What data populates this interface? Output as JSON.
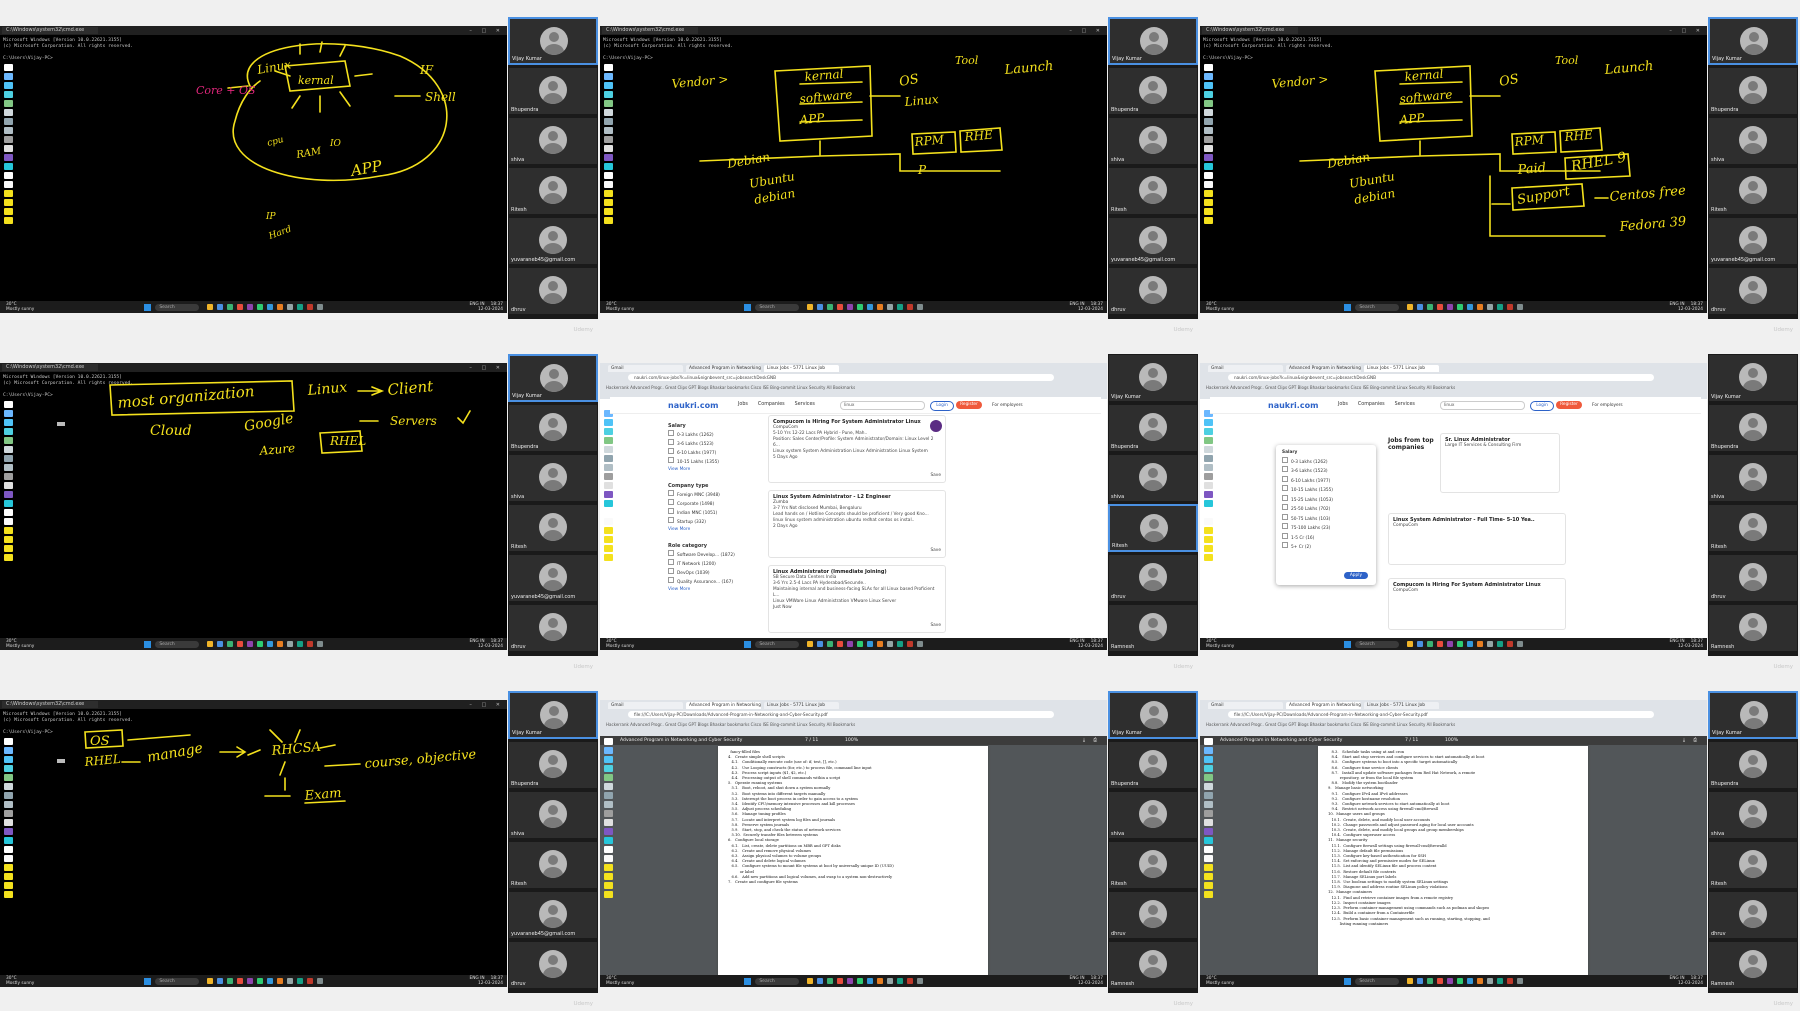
{
  "watermark": "Udemy",
  "participants": [
    "Vijay Kumar",
    "Bhupendra",
    "shiva",
    "Ritesh",
    "yuvaraneb45@gmail.com",
    "dhruv"
  ],
  "participants_alt": [
    "Vijay Kumar",
    "Bhupendra",
    "shiva",
    "Ritesh",
    "dhruv",
    "Ramnesh"
  ],
  "cmd": {
    "window_title": "C:\\Windows\\system32\\cmd.exe",
    "line1": "Microsoft Windows [Version 10.0.22621.3155]",
    "line2": "(c) Microsoft Corporation. All rights reserved.",
    "line3": "C:\\Users\\Vijay-PC>"
  },
  "taskbar": {
    "search": "Search",
    "weather": "30°C",
    "weather_sub": "Mostly sunny",
    "lang": "ENG IN",
    "time": "18:37",
    "date": "12-03-2024"
  },
  "annotations": {
    "t1": [
      "Linux",
      "Core + OS",
      "kernal",
      "IF",
      "Shell",
      "cpu",
      "RAM",
      "IO",
      "APP",
      "IP",
      "Hard"
    ],
    "t2": [
      "Vendor >",
      "kernal",
      "software",
      "APP",
      "OS",
      "Tool",
      "Launch",
      "Linux",
      "Debian",
      "Ubuntu",
      "debian",
      "RPM",
      "RHE",
      "P"
    ],
    "t3": [
      "Vendor >",
      "kernal",
      "software",
      "APP",
      "OS",
      "Tool",
      "Launch",
      "Debian",
      "Ubuntu",
      "debian",
      "RPM",
      "RHE",
      "Paid",
      "RHEL 9",
      "Support",
      "Centos free",
      "Fedora 39"
    ],
    "t4": [
      "most organization",
      "Linux",
      "Client",
      "Cloud",
      "Google",
      "Azure",
      "RHEL",
      "Servers"
    ],
    "t7": [
      "OS",
      "RHEL",
      "manage",
      "RHCSA",
      "course, objective",
      "Exam"
    ]
  },
  "naukri": {
    "logo": "naukri.com",
    "nav": [
      "Jobs",
      "Companies",
      "Services"
    ],
    "search": "linux",
    "login": "Login",
    "register": "Register",
    "employers": "For employers",
    "address": "naukri.com/linux-jobs?k=linux&nignbevent_src=jobsearchDeskGNB",
    "bookmarks": "Hackerrank  Advanced Progr..  Great Clips  GPT  Blogs  Bhaskar bookmarks  Cisco ISE  Bing-commit  Linux Security  All Bookmarks",
    "tabs": [
      "Gmail",
      "Advanced Program in Networking",
      "Linux Jobs - 5771 Linux Job"
    ],
    "filters": {
      "salary_title": "Salary",
      "salary": [
        "0-3 Lakhs (1262)",
        "3-6 Lakhs (1523)",
        "6-10 Lakhs (1977)",
        "10-15 Lakhs (1355)"
      ],
      "company_title": "Company type",
      "company": [
        "Foreign MNC (3948)",
        "Corporate (1498)",
        "Indian MNC (1051)",
        "Startup (332)"
      ],
      "role_title": "Role category",
      "role": [
        "Software Develop... (1872)",
        "IT Network (1200)",
        "DevOps (1039)",
        "Quality Assurance... (167)"
      ],
      "view_more": "View More"
    },
    "jobs": [
      {
        "title": "Compucom is Hiring For System Administrator Linux",
        "company": "CompuCom",
        "meta": "5-10 Yrs   12-22 Lacs PA   Hybrid - Pune, Mah..",
        "desc": "Position: Sales Center/Profile: System Administrator/Domain: Linux Level 2 6...",
        "tags": "Linux system  System Administration  Linux Administration  Linux System",
        "when": "5 Days Ago",
        "save": "Save"
      },
      {
        "title": "Linux System Administrator - L2 Engineer",
        "company": "Zumba",
        "meta": "3-7 Yrs   Not disclosed   Mumbai, Bengaluru",
        "desc": "Lead hands on / Hotline Concepts should be proficient / Very good Kno...",
        "tags": "linux  linux system administration  ubuntu  redhat  centos  os  instal..",
        "when": "2 Days Ago",
        "save": "Save"
      },
      {
        "title": "Linux Administrator (Immediate Joining)",
        "company": "SB Secure Data Centers India",
        "meta": "3-6 Yrs   2.5-4 Lacs PA   Hyderabad/Secunde..",
        "desc": "Maintaining internal and business-facing SLAs for all Linux based Proficient L...",
        "tags": "Linux  VMWare  Linux Administration  VMware  Linux Server",
        "when": "Just Now",
        "save": "Save"
      }
    ],
    "popup": {
      "title": "Salary",
      "items": [
        "0-3 Lakhs (1262)",
        "3-6 Lakhs (1523)",
        "6-10 Lakhs (1977)",
        "10-15 Lakhs (1355)",
        "15-25 Lakhs (1053)",
        "25-50 Lakhs (702)",
        "50-75 Lakhs (103)",
        "75-100 Lakhs (23)",
        "1-5 Cr (16)",
        "5+ Cr (2)"
      ],
      "apply": "Apply"
    },
    "right_jobs": [
      {
        "title": "Sr. Linux Administrator",
        "company": "Large IT Services & Consulting Firm"
      },
      {
        "title": "Linux System Administrator - Full Time- 5-10 Yea..",
        "company": "CompuCom"
      },
      {
        "title": "Compucom is Hiring For System Administrator Linux",
        "company": "CompuCom"
      }
    ],
    "promo": "Jobs from top companies"
  },
  "pdf": {
    "title": "Advanced Program in Networking and Cyber Security",
    "page1": "7 / 11",
    "page2": "7 / 11",
    "zoom": "100%",
    "address": "file:///C:/Users/Vijay-PC/Downloads/Advanced-Program-in-Networking-and-Cyber-Security.pdf",
    "doc1": [
      "  fancy-filled files",
      "4.   Create simple shell scripts",
      "   4.1.   Conditionally execute code (use of: if, test, [], etc.)",
      "   4.2.   Use Looping constructs (for, etc.) to process file, command line input",
      "   4.3.   Process script inputs ($1, $2, etc.)",
      "   4.4.   Processing output of shell commands within a script",
      "5.   Operate running systems",
      "   5.1.   Boot, reboot, and shut down a system normally",
      "   5.2.   Boot systems into different targets manually",
      "   5.3.   Interrupt the boot process in order to gain access to a system",
      "   5.4.   Identify CPU/memory intensive processes and kill processes",
      "   5.5.   Adjust process scheduling",
      "   5.6.   Manage tuning profiles",
      "   5.7.   Locate and interpret system log files and journals",
      "   5.8.   Preserve system journals",
      "   5.9.   Start, stop, and check the status of network services",
      "   5.10.  Securely transfer files between systems",
      "6.   Configure local storage",
      "   6.1.   List, create, delete partitions on MBR and GPT disks",
      "   6.2.   Create and remove physical volumes",
      "   6.3.   Assign physical volumes to volume groups",
      "   6.4.   Create and delete logical volumes",
      "   6.5.   Configure systems to mount file systems at boot by universally unique ID (UUID)",
      "          or label",
      "   6.6.   Add new partitions and logical volumes, and swap to a system non-destructively",
      "7.   Create and configure file systems"
    ],
    "doc2": [
      "   8.3.   Schedule tasks using at and cron",
      "   8.4.   Start and stop services and configure services to start automatically at boot",
      "   8.5.   Configure systems to boot into a specific target automatically",
      "   8.6.   Configure time service clients",
      "   8.7.   Install and update software packages from Red Hat Network, a remote",
      "          repository, or from the local file system",
      "   8.8.   Modify the system bootloader",
      "9.   Manage basic networking",
      "   9.1.   Configure IPv4 and IPv6 addresses",
      "   9.2.   Configure hostname resolution",
      "   9.3.   Configure network services to start automatically at boot",
      "   9.4.   Restrict network access using firewall-cmd/firewall",
      "10.  Manage users and groups",
      "   10.1.  Create, delete, and modify local user accounts",
      "   10.2.  Change passwords and adjust password aging for local user accounts",
      "   10.3.  Create, delete, and modify local groups and group memberships",
      "   10.4.  Configure superuser access",
      "11.  Manage security",
      "   11.1.  Configure firewall settings using firewall-cmd/firewalld",
      "   11.2.  Manage default file permissions",
      "   11.3.  Configure key-based authentication for SSH",
      "   11.4.  Set enforcing and permissive modes for SELinux",
      "   11.5.  List and identify SELinux file and process context",
      "   11.6.  Restore default file contexts",
      "   11.7.  Manage SELinux port labels",
      "   11.8.  Use boolean settings to modify system SELinux settings",
      "   11.9.  Diagnose and address routine SELinux policy violations",
      "12.  Manage containers",
      "   12.1.  Find and retrieve container images from a remote registry",
      "   12.2.  Inspect container images",
      "   12.3.  Perform container management using commands such as podman and skopeo",
      "   12.4.  Build a container from a Containerfile",
      "   12.5.  Perform basic container management such as running, starting, stopping, and",
      "          listing running containers"
    ]
  },
  "colors": {
    "ink": "#f4e11d",
    "ink_pink": "#e0267b",
    "speaker_border": "#4a90e2",
    "register": "#ef5a3c",
    "naukri_blue": "#2d62c8"
  }
}
